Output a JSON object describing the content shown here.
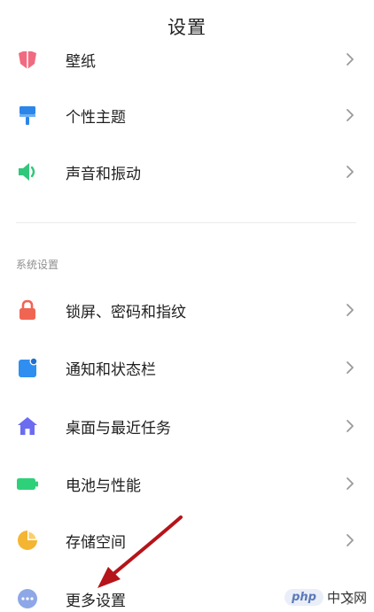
{
  "header": {
    "title": "设置"
  },
  "items_top": [
    {
      "label": "壁纸",
      "icon": "wallpaper-icon"
    },
    {
      "label": "个性主题",
      "icon": "brush-icon"
    },
    {
      "label": "声音和振动",
      "icon": "speaker-icon"
    }
  ],
  "section": {
    "title": "系统设置"
  },
  "items_system": [
    {
      "label": "锁屏、密码和指纹",
      "icon": "lock-icon"
    },
    {
      "label": "通知和状态栏",
      "icon": "notification-icon"
    },
    {
      "label": "桌面与最近任务",
      "icon": "home-icon"
    },
    {
      "label": "电池与性能",
      "icon": "battery-icon"
    },
    {
      "label": "存储空间",
      "icon": "storage-pie-icon"
    },
    {
      "label": "更多设置",
      "icon": "more-icon"
    }
  ],
  "watermark": {
    "brand": "php",
    "text": "中文网"
  },
  "colors": {
    "wallpaper": "#f06b80",
    "theme": "#2c86e8",
    "sound": "#31c77a",
    "lock": "#f06552",
    "notification": "#2f8ef0",
    "home": "#6b6cf0",
    "battery": "#2fd07a",
    "storage": "#f4b533",
    "more": "#8ea7e6",
    "arrow": "#b5141a"
  }
}
